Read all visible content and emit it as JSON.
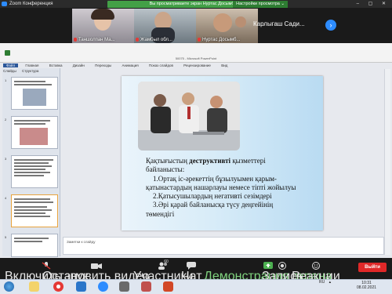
{
  "window": {
    "title": "Zoom Конференция",
    "controls": "– ▢ ✕"
  },
  "banner": {
    "text": "Вы просматриваете экран Нуртас Досымбаевич",
    "view_options": "Настройки просмотра ⌄"
  },
  "participants": [
    {
      "name": "Таншолпан Ма..."
    },
    {
      "name": "Жамбыл обл..."
    },
    {
      "name": "Нуртас Досымб..."
    }
  ],
  "active_speaker": "Карлыгаш Сади...",
  "next_page_glyph": "›",
  "ppt": {
    "doc_title": "50075 - Microsoft PowerPoint",
    "menu": [
      "Файл",
      "Главная",
      "Вставка",
      "Дизайн",
      "Переходы",
      "Анимация",
      "Показ слайдов",
      "Рецензирование",
      "Вид"
    ],
    "panel_tabs": [
      "Слайды",
      "Структура"
    ],
    "thumbnails": [
      {
        "num": "1",
        "text": "Қақтығыстың деструктивті қызметтері"
      },
      {
        "num": "2",
        "text": ""
      },
      {
        "num": "3",
        "text": "Конструктивті қызметтері"
      },
      {
        "num": "4",
        "text": "Қақтығыстың жағдайлары"
      },
      {
        "num": "5",
        "text": ""
      },
      {
        "num": "6",
        "text": ""
      }
    ],
    "slide": {
      "line1_a": "Қақтығыстың ",
      "line1_b": "деструктивті",
      "line1_c": " қызметтері",
      "line2": "байланысты:",
      "line3": "1.Ортақ іс-әрекеттің бұзылуымен қарым-",
      "line4": "қатынастардың нашарлауы немесе тіпті жойылуы",
      "line5": "2.Қатысушылардың негативті сезімдері",
      "line6": "3.Әрі қарай байланысқа түсу деңгейінің",
      "line7": "төмендігі"
    },
    "notes_placeholder": "Заметки к слайду"
  },
  "toolbar": {
    "mute": "Включить звук",
    "video": "Остановить видео",
    "participants": "Участники",
    "participants_count": "60",
    "chat": "Чат",
    "share": "Демонстрация экрана",
    "record": "Запись",
    "reactions": "Реакции",
    "leave": "Выйти"
  },
  "taskbar": {
    "lang": "RU",
    "time": "10:31",
    "date": "08.02.2021"
  },
  "colors": {
    "zoom_blue": "#2d8cff",
    "banner_green": "#43a047",
    "leave_red": "#e02828"
  }
}
